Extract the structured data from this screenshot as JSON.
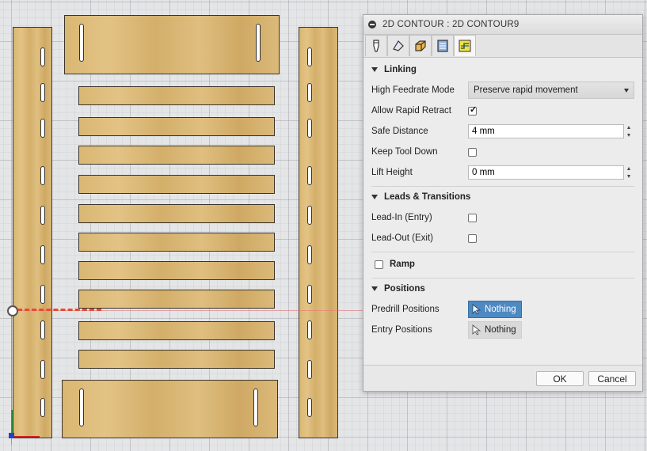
{
  "panel": {
    "title": "2D CONTOUR : 2D CONTOUR9",
    "tabs": [
      {
        "icon": "tool-icon"
      },
      {
        "icon": "geometry-icon"
      },
      {
        "icon": "heights-icon"
      },
      {
        "icon": "passes-icon"
      },
      {
        "icon": "linking-icon",
        "active": true
      }
    ]
  },
  "linking": {
    "heading": "Linking",
    "high_feedrate_mode": {
      "label": "High Feedrate Mode",
      "value": "Preserve rapid movement"
    },
    "allow_rapid_retract": {
      "label": "Allow Rapid Retract",
      "checked": true
    },
    "safe_distance": {
      "label": "Safe Distance",
      "value": "4 mm"
    },
    "keep_tool_down": {
      "label": "Keep Tool Down",
      "checked": false
    },
    "lift_height": {
      "label": "Lift Height",
      "value": "0 mm"
    }
  },
  "leads": {
    "heading": "Leads & Transitions",
    "lead_in": {
      "label": "Lead-In (Entry)",
      "checked": false
    },
    "lead_out": {
      "label": "Lead-Out (Exit)",
      "checked": false
    }
  },
  "ramp": {
    "label": "Ramp",
    "checked": false
  },
  "positions": {
    "heading": "Positions",
    "predrill": {
      "label": "Predrill Positions",
      "button": "Nothing"
    },
    "entry": {
      "label": "Entry Positions",
      "button": "Nothing"
    }
  },
  "footer": {
    "ok": "OK",
    "cancel": "Cancel"
  },
  "colors": {
    "accent": "#4e89c2",
    "wood": "#dcba78",
    "axis_x": "#d0261f",
    "axis_y": "#29a33a",
    "axis_z": "#2a3fc8"
  }
}
